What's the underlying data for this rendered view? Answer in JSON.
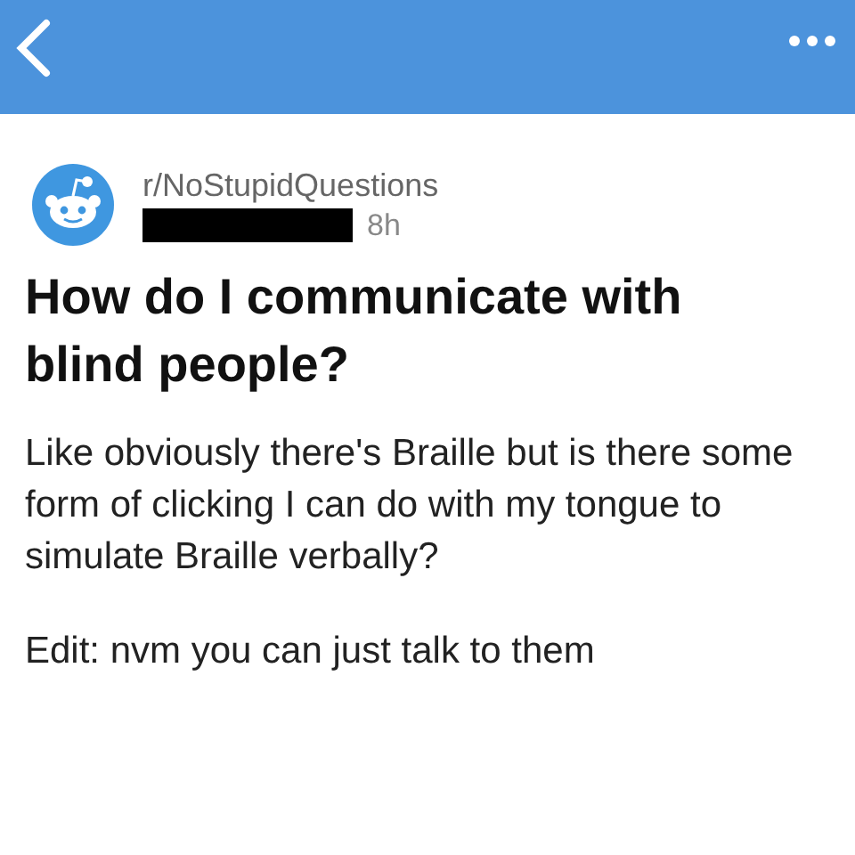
{
  "header": {
    "subreddit": "r/NoStupidQuestions",
    "time": "8h"
  },
  "post": {
    "title": "How do I communicate with blind people?",
    "paragraphs": [
      "Like obviously there's Braille but is there some form of clicking I can do with my tongue to simulate Braille verbally?",
      "Edit: nvm you can just talk to them"
    ]
  }
}
